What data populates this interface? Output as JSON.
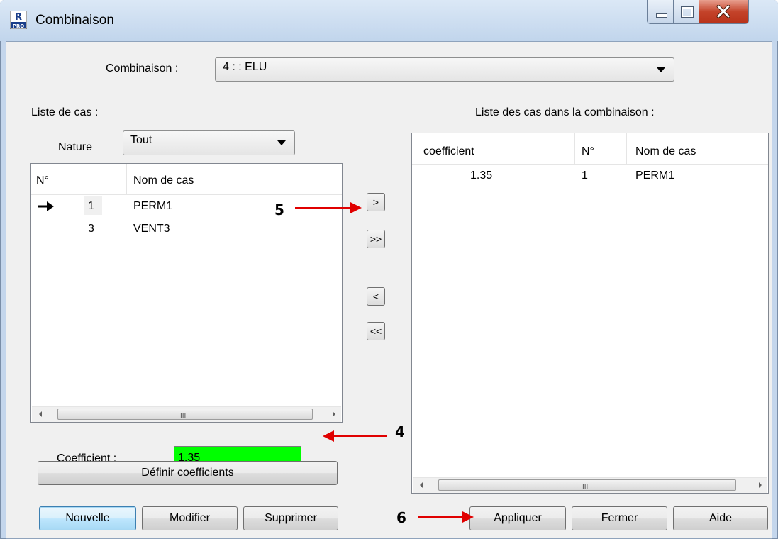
{
  "window": {
    "title": "Combinaison",
    "icon_top": "R",
    "icon_bottom": "PRO"
  },
  "combinaison": {
    "label": "Combinaison :",
    "value": "4 :  : ELU"
  },
  "left": {
    "title": "Liste de cas :",
    "nature_label": "Nature",
    "nature_value": "Tout",
    "columns": {
      "num": "N°",
      "name": "Nom de cas"
    },
    "rows": [
      {
        "num": "1",
        "name": "PERM1",
        "current": true
      },
      {
        "num": "3",
        "name": "VENT3",
        "current": false
      }
    ],
    "scroll_grip": "III"
  },
  "right": {
    "title": "Liste des cas dans la combinaison :",
    "columns": {
      "coef": "coefficient",
      "num": "N°",
      "name": "Nom de cas"
    },
    "rows": [
      {
        "coef": "1.35",
        "num": "1",
        "name": "PERM1"
      }
    ],
    "scroll_grip": "III"
  },
  "transfer": {
    "add": ">",
    "add_all": ">>",
    "remove": "<",
    "remove_all": "<<"
  },
  "coefficient": {
    "label": "Coefficient :",
    "value": "1,35",
    "field_color": "#00ff00"
  },
  "buttons": {
    "define": "Définir coefficients",
    "nouvelle": "Nouvelle",
    "modifier": "Modifier",
    "supprimer": "Supprimer",
    "appliquer": "Appliquer",
    "fermer": "Fermer",
    "aide": "Aide"
  },
  "annotations": {
    "a4": "4",
    "a5": "5",
    "a6": "6",
    "color": "#e00000"
  }
}
